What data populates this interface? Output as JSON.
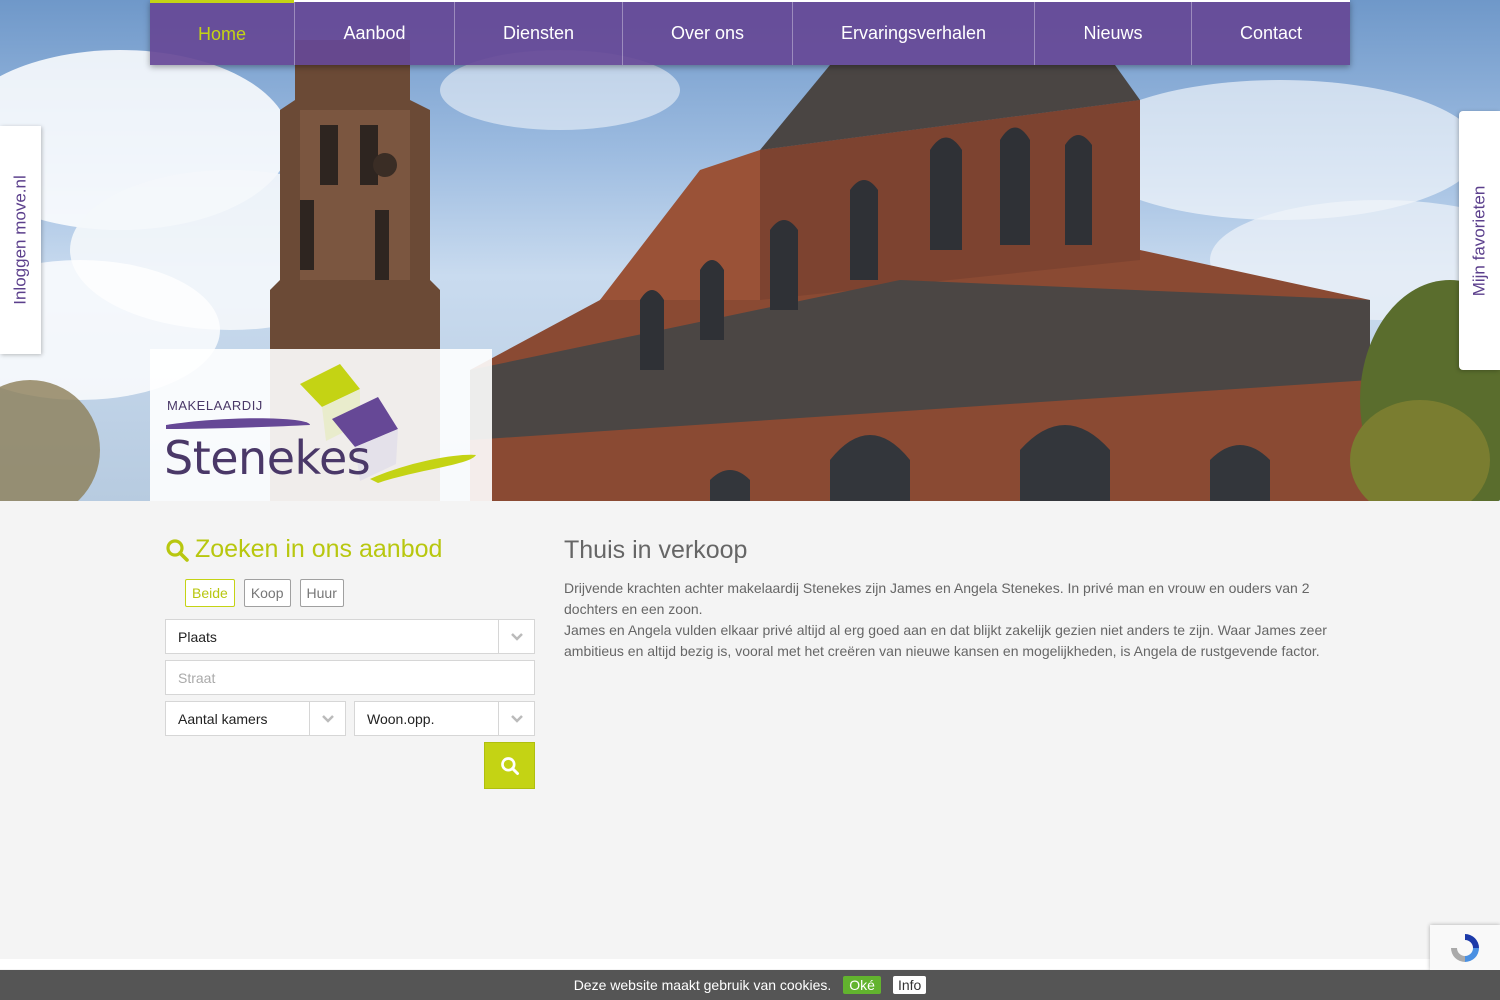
{
  "nav": {
    "items": [
      {
        "label": "Home",
        "active": true
      },
      {
        "label": "Aanbod"
      },
      {
        "label": "Diensten"
      },
      {
        "label": "Over ons"
      },
      {
        "label": "Ervaringsverhalen"
      },
      {
        "label": "Nieuws"
      },
      {
        "label": "Contact"
      }
    ]
  },
  "side": {
    "login": "Inloggen move.nl",
    "favorites": "Mijn favorieten"
  },
  "logo": {
    "small": "MAKELAARDIJ",
    "big": "Stenekes"
  },
  "search": {
    "title": "Zoeken in ons aanbod",
    "filters": [
      "Beide",
      "Koop",
      "Huur"
    ],
    "place_select": "Plaats",
    "street_placeholder": "Straat",
    "rooms_select": "Aantal kamers",
    "area_select": "Woon.opp."
  },
  "content": {
    "title": "Thuis in verkoop",
    "paragraph1": "Drijvende krachten achter makelaardij Stenekes zijn James en Angela Stenekes. In privé man en vrouw en ouders van 2 dochters en een zoon.",
    "paragraph2": "James en Angela vulden elkaar privé altijd al erg goed aan en dat blijkt zakelijk gezien niet anders te zijn. Waar James zeer ambitieus en altijd bezig is, vooral met het creëren van nieuwe kansen en mogelijkheden, is Angela de rustgevende factor."
  },
  "cookie": {
    "text": "Deze website maakt gebruik van cookies.",
    "ok": "Oké",
    "info": "Info"
  },
  "colors": {
    "brand_purple": "#664896",
    "brand_green": "#c4d314"
  }
}
